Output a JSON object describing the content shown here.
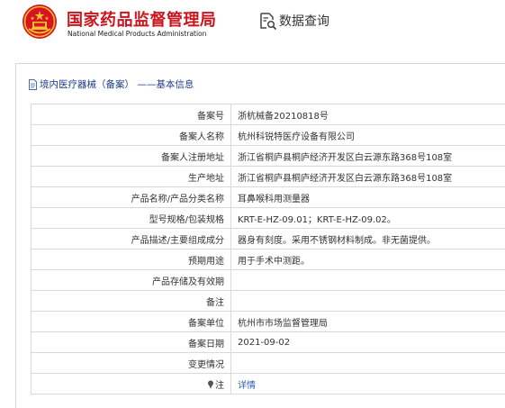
{
  "header": {
    "title_cn": "国家药品监督管理局",
    "title_en": "National Medical Products Administration",
    "query_label": "数据查询",
    "query_icon": "search-document-icon",
    "brand_color": "#c9151e"
  },
  "breadcrumb": {
    "text": "境内医疗器械（备案） ——基本信息",
    "icon": "document-icon"
  },
  "record": {
    "rows": [
      {
        "label": "备案号",
        "value": "浙杭械备20210818号"
      },
      {
        "label": "备案人名称",
        "value": "杭州科锐特医疗设备有限公司"
      },
      {
        "label": "备案人注册地址",
        "value": "浙江省桐庐县桐庐经济开发区白云源东路368号108室"
      },
      {
        "label": "生产地址",
        "value": "浙江省桐庐县桐庐经济开发区白云源东路368号108室"
      },
      {
        "label": "产品名称/产品分类名称",
        "value": "耳鼻喉科用测量器"
      },
      {
        "label": "型号规格/包装规格",
        "value": "KRT-E-HZ-09.01；KRT-E-HZ-09.02。"
      },
      {
        "label": "产品描述/主要组成成分",
        "value": "器身有刻度。采用不锈钢材料制成。非无菌提供。"
      },
      {
        "label": "预期用途",
        "value": "用于手术中测距。"
      },
      {
        "label": "产品存储及有效期",
        "value": ""
      },
      {
        "label": "备注",
        "value": ""
      },
      {
        "label": "备案单位",
        "value": "杭州市市场监督管理局"
      },
      {
        "label": "备案日期",
        "value": "2021-09-02"
      },
      {
        "label": "变更情况",
        "value": ""
      }
    ],
    "note_label": "注",
    "note_icon": "pin-icon",
    "detail_link": "详情",
    "link_color": "#2d63b5"
  }
}
